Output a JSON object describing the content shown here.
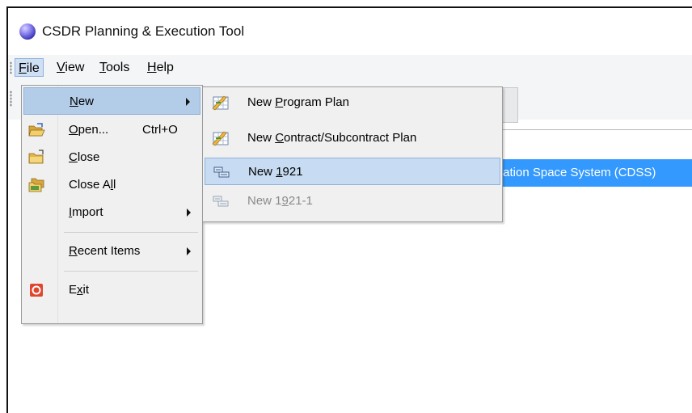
{
  "window": {
    "title": "CSDR Planning & Execution Tool"
  },
  "menubar": {
    "items": [
      {
        "pre": "",
        "mn": "F",
        "post": "ile"
      },
      {
        "pre": "",
        "mn": "V",
        "post": "iew"
      },
      {
        "pre": "",
        "mn": "T",
        "post": "ools"
      },
      {
        "pre": "",
        "mn": "H",
        "post": "elp"
      }
    ]
  },
  "file_menu": {
    "items": [
      {
        "pre": "",
        "mn": "N",
        "post": "ew",
        "shortcut": ""
      },
      {
        "pre": "",
        "mn": "O",
        "post": "pen...",
        "shortcut": "Ctrl+O"
      },
      {
        "pre": "",
        "mn": "C",
        "post": "lose",
        "shortcut": ""
      },
      {
        "pre": "Close A",
        "mn": "l",
        "post": "l",
        "shortcut": ""
      },
      {
        "pre": "",
        "mn": "I",
        "post": "mport",
        "shortcut": ""
      },
      {
        "pre": "",
        "mn": "R",
        "post": "ecent Items",
        "shortcut": ""
      },
      {
        "pre": "E",
        "mn": "x",
        "post": "it",
        "shortcut": ""
      }
    ]
  },
  "new_submenu": {
    "items": [
      {
        "pre": "New ",
        "mn": "P",
        "post": "rogram Plan"
      },
      {
        "pre": "New ",
        "mn": "C",
        "post": "ontract/Subcontract Plan"
      },
      {
        "pre": "New ",
        "mn": "1",
        "post": "921"
      },
      {
        "pre": "New 1",
        "mn": "9",
        "post": "21-1"
      }
    ]
  },
  "tree": {
    "selected_node_visible_text": "tration Space System (CDSS)"
  },
  "colors": {
    "selection": "#3399ff",
    "menu_hover": "#b3cde8"
  }
}
